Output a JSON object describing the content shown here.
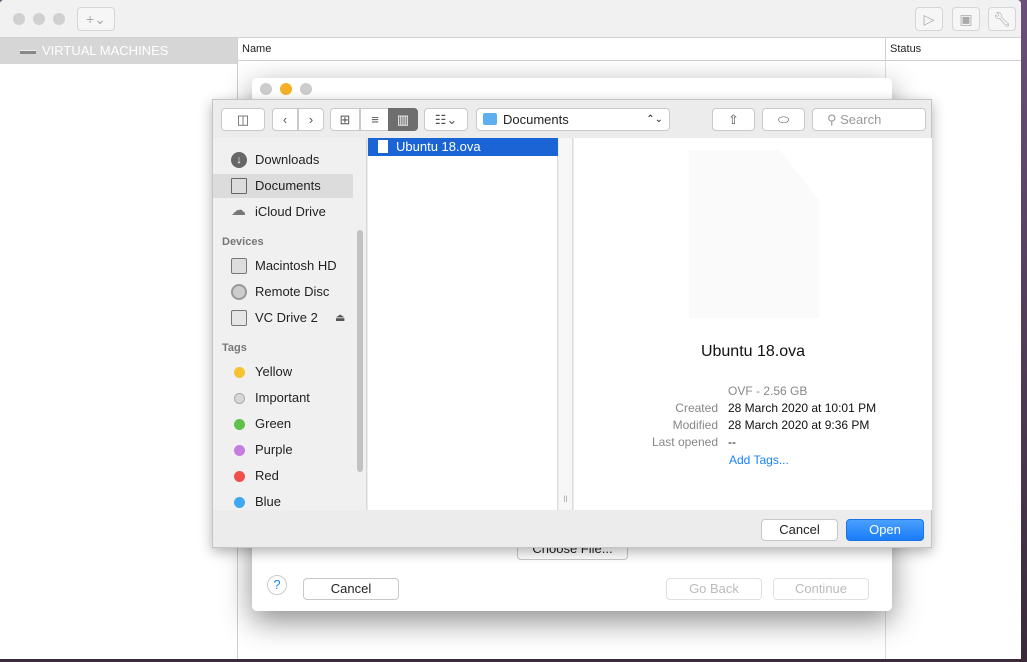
{
  "app": {
    "sidebar_header": "VIRTUAL MACHINES",
    "columns": [
      "Name",
      "Status"
    ],
    "add_button": "+⌄",
    "toolbar_icons": [
      "play-icon",
      "snapshot-icon",
      "wrench-icon"
    ]
  },
  "wizard": {
    "choose_file": "Choose File...",
    "help": "?",
    "cancel": "Cancel",
    "go_back": "Go Back",
    "continue": "Continue"
  },
  "open_panel": {
    "location": "Documents",
    "search_placeholder": "Search",
    "sidebar": {
      "favorites": [
        {
          "label": "Downloads",
          "icon": "downloads-icon"
        },
        {
          "label": "Documents",
          "icon": "documents-icon",
          "selected": true
        },
        {
          "label": "iCloud Drive",
          "icon": "cloud-icon"
        }
      ],
      "devices_title": "Devices",
      "devices": [
        {
          "label": "Macintosh HD",
          "icon": "hard-drive-icon"
        },
        {
          "label": "Remote Disc",
          "icon": "disc-icon"
        },
        {
          "label": "VC Drive 2",
          "icon": "drive-icon",
          "eject": "⏏"
        }
      ],
      "tags_title": "Tags",
      "tags": [
        {
          "label": "Yellow",
          "color": "#f5c230"
        },
        {
          "label": "Important",
          "color": "#d8d8d8"
        },
        {
          "label": "Green",
          "color": "#5ec14a"
        },
        {
          "label": "Purple",
          "color": "#c57ee0"
        },
        {
          "label": "Red",
          "color": "#f0504a"
        },
        {
          "label": "Blue",
          "color": "#3ea8f0"
        }
      ]
    },
    "files": [
      {
        "name": "Ubuntu 18.ova",
        "selected": true
      }
    ],
    "preview": {
      "name": "Ubuntu 18.ova",
      "kind": "OVF - 2.56 GB",
      "created_label": "Created",
      "created": "28 March 2020 at 10:01 PM",
      "modified_label": "Modified",
      "modified": "28 March 2020 at 9:36 PM",
      "last_opened_label": "Last opened",
      "last_opened": "--",
      "add_tags": "Add Tags..."
    },
    "cancel": "Cancel",
    "open": "Open",
    "accent": "#1a82fb"
  }
}
